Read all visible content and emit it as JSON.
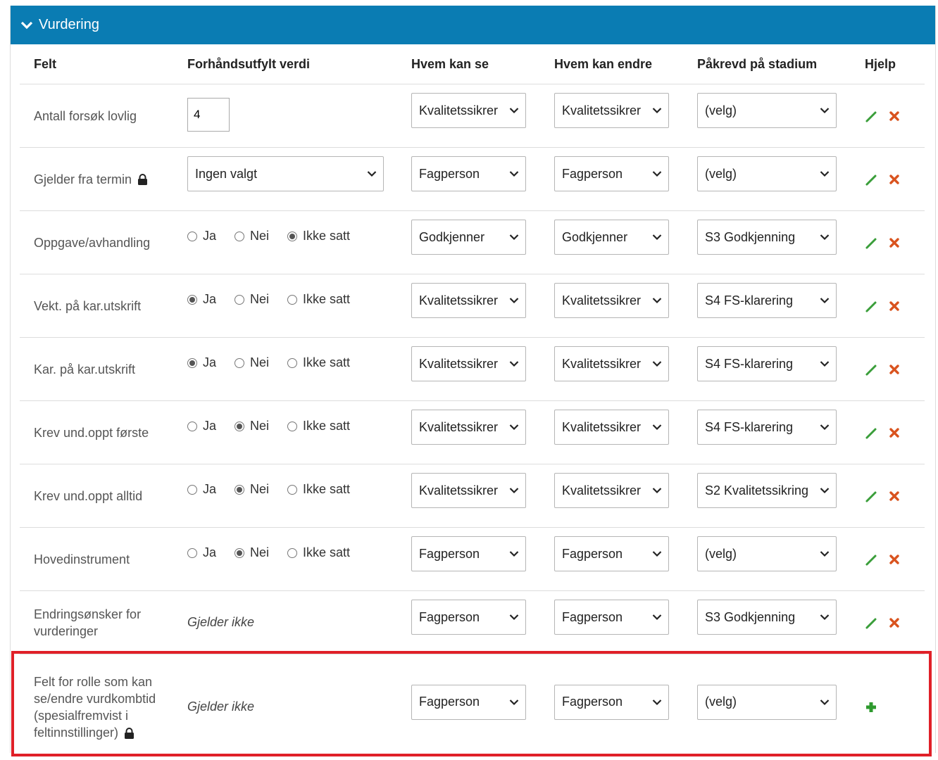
{
  "section": {
    "title": "Vurdering"
  },
  "columns": {
    "felt": "Felt",
    "prefilled": "Forhåndsutfylt verdi",
    "can_see": "Hvem kan se",
    "can_edit": "Hvem kan endre",
    "required_stage": "Påkrevd på stadium",
    "help": "Hjelp"
  },
  "radio_labels": {
    "yes": "Ja",
    "no": "Nei",
    "unset": "Ikke satt"
  },
  "colors": {
    "header_bg": "#0a7cb3",
    "edit_icon": "#3a9e3a",
    "delete_icon": "#d9531e",
    "add_icon": "#2e9a2e",
    "highlight_border": "#e02028"
  },
  "rows": [
    {
      "label": "Antall forsøk lovlig",
      "locked": false,
      "prefill_type": "number",
      "prefill_value": "4",
      "can_see": "Kvalitetssikrer",
      "can_edit": "Kvalitetssikrer",
      "stage": "(velg)",
      "actions": [
        "edit-icon",
        "delete-icon"
      ]
    },
    {
      "label": "Gjelder fra termin",
      "locked": true,
      "prefill_type": "select",
      "prefill_value": "Ingen valgt",
      "can_see": "Fagperson",
      "can_edit": "Fagperson",
      "stage": "(velg)",
      "actions": [
        "edit-icon",
        "delete-icon"
      ]
    },
    {
      "label": "Oppgave/avhandling",
      "locked": false,
      "prefill_type": "radio",
      "prefill_value": "Ikke satt",
      "can_see": "Godkjenner",
      "can_edit": "Godkjenner",
      "stage": "S3 Godkjenning",
      "actions": [
        "edit-icon",
        "delete-icon"
      ]
    },
    {
      "label": "Vekt. på kar.utskrift",
      "locked": false,
      "prefill_type": "radio",
      "prefill_value": "Ja",
      "can_see": "Kvalitetssikrer",
      "can_edit": "Kvalitetssikrer",
      "stage": "S4 FS-klarering",
      "actions": [
        "edit-icon",
        "delete-icon"
      ]
    },
    {
      "label": "Kar. på kar.utskrift",
      "locked": false,
      "prefill_type": "radio",
      "prefill_value": "Ja",
      "can_see": "Kvalitetssikrer",
      "can_edit": "Kvalitetssikrer",
      "stage": "S4 FS-klarering",
      "actions": [
        "edit-icon",
        "delete-icon"
      ]
    },
    {
      "label": "Krev und.oppt første",
      "locked": false,
      "prefill_type": "radio",
      "prefill_value": "Nei",
      "can_see": "Kvalitetssikrer",
      "can_edit": "Kvalitetssikrer",
      "stage": "S4 FS-klarering",
      "actions": [
        "edit-icon",
        "delete-icon"
      ]
    },
    {
      "label": "Krev und.oppt alltid",
      "locked": false,
      "prefill_type": "radio",
      "prefill_value": "Nei",
      "can_see": "Kvalitetssikrer",
      "can_edit": "Kvalitetssikrer",
      "stage": "S2 Kvalitetssikring",
      "actions": [
        "edit-icon",
        "delete-icon"
      ]
    },
    {
      "label": "Hovedinstrument",
      "locked": false,
      "prefill_type": "radio",
      "prefill_value": "Nei",
      "can_see": "Fagperson",
      "can_edit": "Fagperson",
      "stage": "(velg)",
      "actions": [
        "edit-icon",
        "delete-icon"
      ]
    },
    {
      "label": "Endringsønsker for vurderinger",
      "locked": false,
      "prefill_type": "text",
      "prefill_value": "Gjelder ikke",
      "can_see": "Fagperson",
      "can_edit": "Fagperson",
      "stage": "S3 Godkjenning",
      "actions": [
        "edit-icon",
        "delete-icon"
      ]
    },
    {
      "label": "Felt for rolle som kan se/endre vurdkombtid (spesialfremvist i feltinnstillinger)",
      "locked": true,
      "prefill_type": "text",
      "prefill_value": "Gjelder ikke",
      "can_see": "Fagperson",
      "can_edit": "Fagperson",
      "stage": "(velg)",
      "actions": [
        "add-icon"
      ]
    }
  ]
}
